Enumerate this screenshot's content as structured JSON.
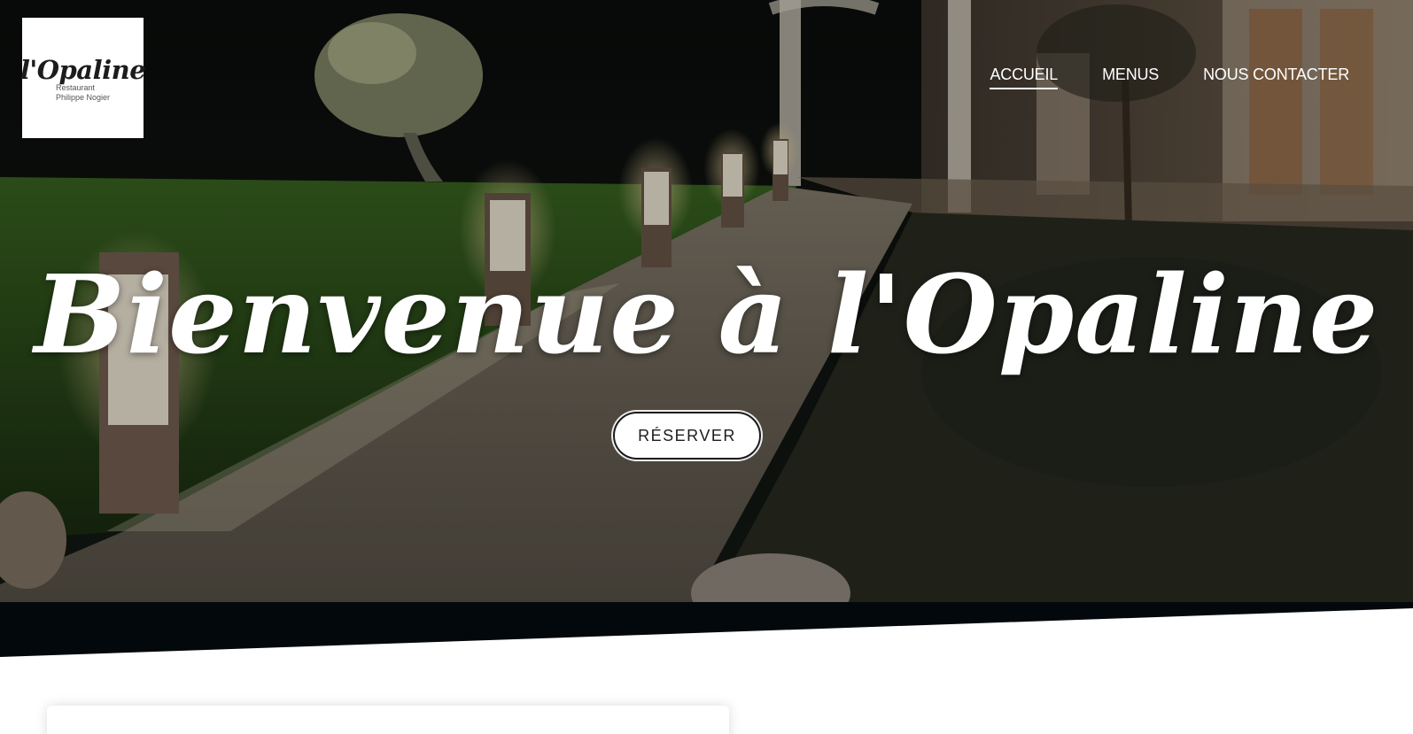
{
  "logo": {
    "wordmark": "l'Opaline",
    "subline1": "Restaurant",
    "subline2": "Philippe Nogier"
  },
  "nav": {
    "items": [
      {
        "label": "ACCUEIL",
        "active": true
      },
      {
        "label": "MENUS",
        "active": false
      },
      {
        "label": "NOUS CONTACTER",
        "active": false
      }
    ]
  },
  "hero": {
    "title": "Bienvenue à l'Opaline",
    "button_label": "RÉSERVER"
  },
  "colors": {
    "band": "#03080c",
    "text": "#ffffff",
    "button_bg": "#ffffff",
    "button_text": "#1c1c1c"
  }
}
